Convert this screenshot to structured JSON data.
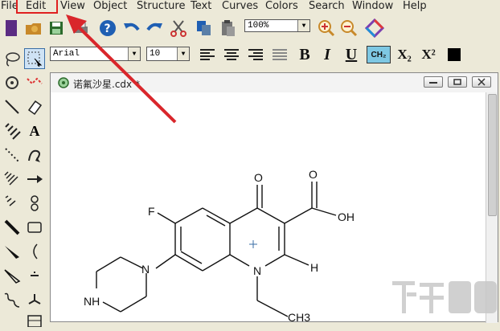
{
  "menubar": {
    "items": [
      {
        "label": "File",
        "u": "F"
      },
      {
        "label": "Edit",
        "u": "E"
      },
      {
        "label": "View",
        "u": "V"
      },
      {
        "label": "Object",
        "u": "O"
      },
      {
        "label": "Structure",
        "u": "S"
      },
      {
        "label": "Text",
        "u": "x"
      },
      {
        "label": "Curves",
        "u": "C"
      },
      {
        "label": "Colors",
        "u": "l"
      },
      {
        "label": "Search",
        "u": "r"
      },
      {
        "label": "Window",
        "u": "W"
      },
      {
        "label": "Help",
        "u": "H"
      }
    ]
  },
  "toolbar": {
    "zoom_value": "100%",
    "font_value": "Arial",
    "font_size_value": "10",
    "bold": "B",
    "italic": "I",
    "underline": "U",
    "ch2": "CH₂",
    "subscript": "X₂",
    "superscript": "X²"
  },
  "document": {
    "title": "诺氟沙星.cdx",
    "dirty_marker": "*"
  },
  "molecule_labels": {
    "o_top": "O",
    "o_acid": "O",
    "oh": "OH",
    "f": "F",
    "n_ring": "N",
    "n_pip": "N",
    "nh": "NH",
    "h": "H",
    "ch3": "CH3"
  },
  "palette": {
    "text_tool": "A"
  },
  "colors": {
    "annotation_red": "#d9262b",
    "icon_blue": "#1f5fb3",
    "icon_purple": "#5b2c83"
  }
}
